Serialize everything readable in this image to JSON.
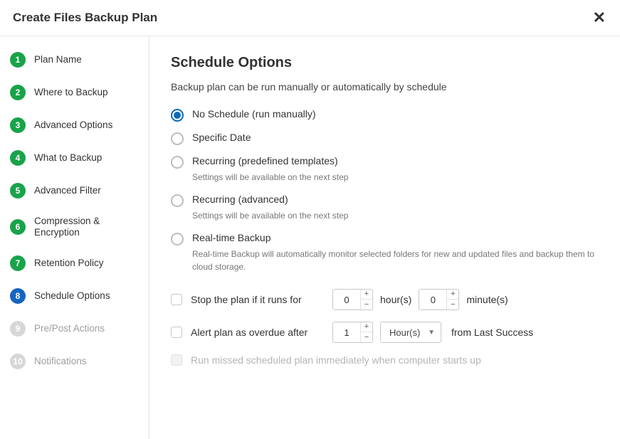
{
  "header": {
    "title": "Create Files Backup Plan"
  },
  "sidebar": {
    "steps": [
      {
        "num": "1",
        "label": "Plan Name",
        "state": "complete"
      },
      {
        "num": "2",
        "label": "Where to Backup",
        "state": "complete"
      },
      {
        "num": "3",
        "label": "Advanced Options",
        "state": "complete"
      },
      {
        "num": "4",
        "label": "What to Backup",
        "state": "complete"
      },
      {
        "num": "5",
        "label": "Advanced Filter",
        "state": "complete"
      },
      {
        "num": "6",
        "label": "Compression & Encryption",
        "state": "complete"
      },
      {
        "num": "7",
        "label": "Retention Policy",
        "state": "complete"
      },
      {
        "num": "8",
        "label": "Schedule Options",
        "state": "current"
      },
      {
        "num": "9",
        "label": "Pre/Post Actions",
        "state": "upcoming"
      },
      {
        "num": "10",
        "label": "Notifications",
        "state": "upcoming"
      }
    ]
  },
  "main": {
    "title": "Schedule Options",
    "subtitle": "Backup plan can be run manually or automatically by schedule",
    "radios": {
      "no_schedule": {
        "label": "No Schedule (run manually)",
        "selected": true
      },
      "specific_date": {
        "label": "Specific Date"
      },
      "recurring_predef": {
        "label": "Recurring (predefined templates)",
        "hint": "Settings will be available on the next step"
      },
      "recurring_adv": {
        "label": "Recurring (advanced)",
        "hint": "Settings will be available on the next step"
      },
      "realtime": {
        "label": "Real-time Backup",
        "hint": "Real-time Backup will automatically monitor selected folders for new and updated files and backup them to cloud storage."
      }
    },
    "stop_plan": {
      "label": "Stop the plan if it runs for",
      "hours": "0",
      "hours_unit": "hour(s)",
      "minutes": "0",
      "minutes_unit": "minute(s)"
    },
    "alert": {
      "label": "Alert plan as overdue after",
      "value": "1",
      "unit": "Hour(s)",
      "trail": "from Last Success"
    },
    "missed": {
      "label": "Run missed scheduled plan immediately when computer starts up"
    }
  }
}
